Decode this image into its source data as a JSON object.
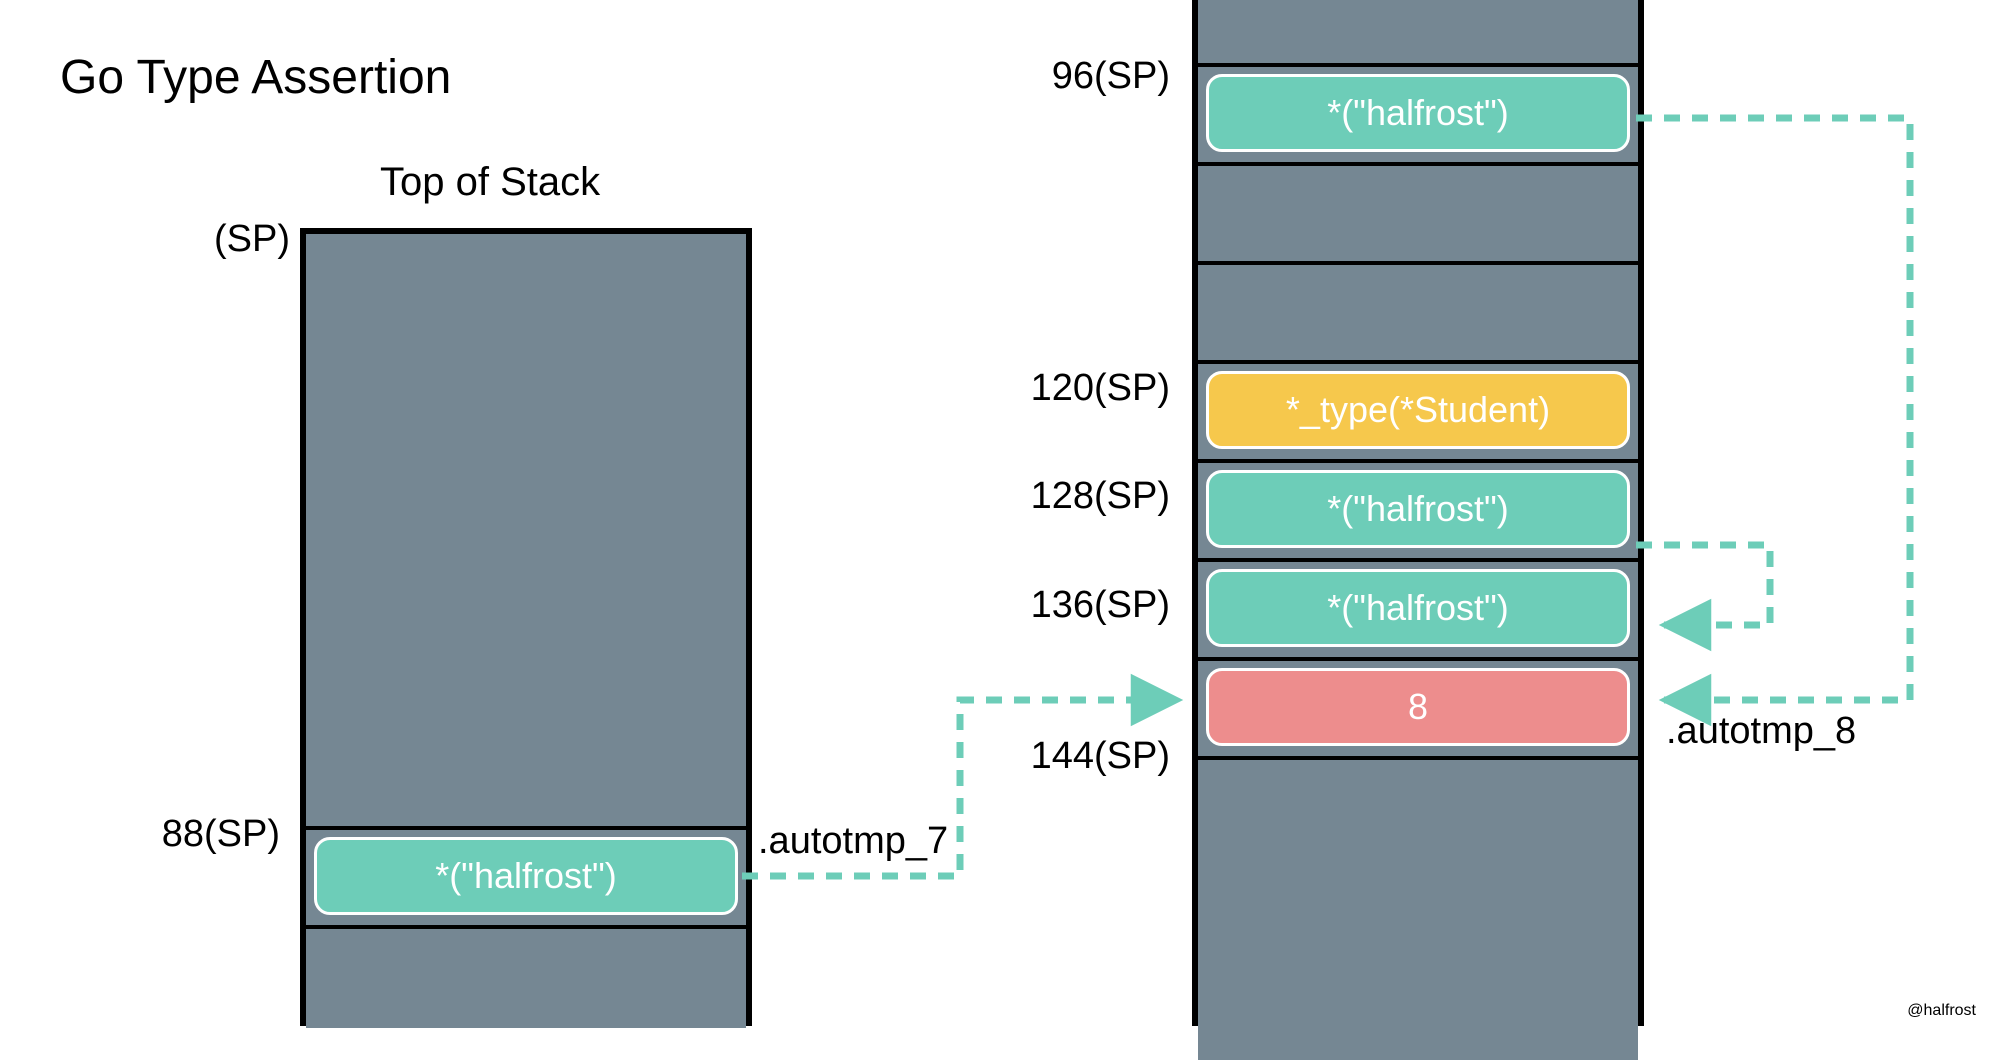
{
  "title": "Go Type Assertion",
  "topOfStack": "Top of Stack",
  "leftStack": {
    "spLabel": "(SP)",
    "offset88": "88(SP)",
    "cell88": "*(\"halfrost\")"
  },
  "rightStack": {
    "offset96": "96(SP)",
    "cell96": "*(\"halfrost\")",
    "offset120": "120(SP)",
    "cell120": "*_type(*Student)",
    "offset128": "128(SP)",
    "cell128": "*(\"halfrost\")",
    "offset136": "136(SP)",
    "cell136": "*(\"halfrost\")",
    "offset144": "144(SP)",
    "cell144": "8"
  },
  "autotmp7": ".autotmp_7",
  "autotmp8": ".autotmp_8",
  "credit": "@halfrost",
  "colors": {
    "teal": "#6dcdb8",
    "gray": "#758793",
    "yellow": "#f6c84c",
    "red": "#ed8d8d"
  }
}
